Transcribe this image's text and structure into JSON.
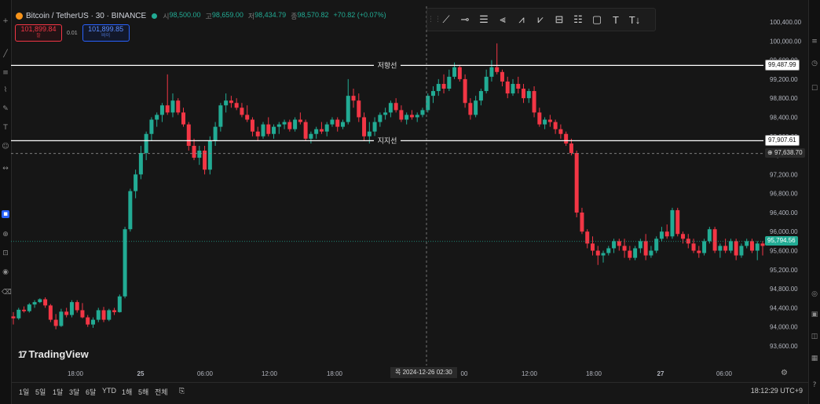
{
  "symbol": {
    "title": "Bitcoin / TetherUS · 30 · BINANCE",
    "ohlc": [
      {
        "label": "시",
        "value": "98,500.00"
      },
      {
        "label": "고",
        "value": "98,659.00"
      },
      {
        "label": "저",
        "value": "98,434.79"
      },
      {
        "label": "종",
        "value": "98,570.82"
      },
      {
        "label": "",
        "value": "+70.82 (+0.07%)"
      }
    ]
  },
  "orders": {
    "sell_price": "101,899.84",
    "sell_label": "팔",
    "spread": "0.01",
    "buy_price": "101,899.85",
    "buy_label": "바이"
  },
  "drawing_tools": [
    "trend-line",
    "horizontal-ray",
    "parallel-channel",
    "pitchfork",
    "zigzag-pattern",
    "long-position",
    "price-range",
    "rectangle",
    "text",
    "anchored-text"
  ],
  "price_axis": {
    "min": 93400,
    "max": 100600,
    "ticks": [
      "100,400.00",
      "100,000.00",
      "99,600.00",
      "99,200.00",
      "98,800.00",
      "98,400.00",
      "98,000.00",
      "97,600.00",
      "97,200.00",
      "96,800.00",
      "96,400.00",
      "96,000.00",
      "95,600.00",
      "95,200.00",
      "94,800.00",
      "94,400.00",
      "94,000.00",
      "93,600.00"
    ]
  },
  "time_axis": {
    "labels": [
      "18:00",
      "25",
      "06:00",
      "12:00",
      "18:00",
      "00",
      "12:00",
      "18:00",
      "27",
      "06:00"
    ]
  },
  "lines": {
    "resistance": {
      "label": "저항선",
      "price": 99487.99,
      "tag": "99,487.99"
    },
    "support": {
      "label": "지지선",
      "price": 97907.61,
      "tag": "97,907.61"
    }
  },
  "crosshair": {
    "price_tag": "97,638.70",
    "time_tag": "목 2024-12-26   02:30",
    "price": 97638.7
  },
  "last_price_tag": "95,794.56",
  "logo_text": "TradingView",
  "bottom": {
    "ranges": [
      "1일",
      "5일",
      "1달",
      "3달",
      "6달",
      "YTD",
      "1해",
      "5해",
      "전체"
    ],
    "clock": "18:12:29 UTC+9"
  },
  "colors": {
    "up": "#22ab94",
    "down": "#f23645",
    "background": "#161616"
  },
  "chart_data": {
    "type": "candlestick",
    "candles": [
      [
        94220,
        94310,
        94050,
        94180
      ],
      [
        94180,
        94400,
        94150,
        94360
      ],
      [
        94360,
        94430,
        94300,
        94330
      ],
      [
        94330,
        94500,
        94300,
        94470
      ],
      [
        94470,
        94560,
        94400,
        94520
      ],
      [
        94520,
        94600,
        94500,
        94580
      ],
      [
        94580,
        94620,
        94400,
        94450
      ],
      [
        94450,
        94480,
        94100,
        94150
      ],
      [
        94150,
        94270,
        93950,
        94020
      ],
      [
        94020,
        94380,
        94000,
        94320
      ],
      [
        94320,
        94400,
        94200,
        94250
      ],
      [
        94250,
        94560,
        94200,
        94520
      ],
      [
        94520,
        94560,
        94300,
        94350
      ],
      [
        94350,
        94500,
        94180,
        94200
      ],
      [
        94200,
        94250,
        94000,
        94050
      ],
      [
        94050,
        94200,
        93980,
        94150
      ],
      [
        94150,
        94400,
        94100,
        94350
      ],
      [
        94350,
        94420,
        94100,
        94150
      ],
      [
        94150,
        94380,
        94120,
        94350
      ],
      [
        94350,
        94400,
        94250,
        94310
      ],
      [
        94310,
        94680,
        94300,
        94640
      ],
      [
        94640,
        96100,
        94600,
        96050
      ],
      [
        96050,
        96900,
        96000,
        96850
      ],
      [
        96850,
        97300,
        96700,
        97200
      ],
      [
        97200,
        97800,
        97100,
        97650
      ],
      [
        97650,
        98100,
        97500,
        98050
      ],
      [
        98050,
        98400,
        97900,
        98350
      ],
      [
        98350,
        98500,
        98200,
        98450
      ],
      [
        98450,
        98700,
        98300,
        98650
      ],
      [
        98650,
        99300,
        98450,
        98500
      ],
      [
        98500,
        98900,
        98400,
        98750
      ],
      [
        98750,
        98800,
        98450,
        98500
      ],
      [
        98500,
        98600,
        98200,
        98250
      ],
      [
        98250,
        98300,
        97700,
        97800
      ],
      [
        97800,
        97950,
        97500,
        97550
      ],
      [
        97550,
        97800,
        97400,
        97700
      ],
      [
        97700,
        97800,
        97200,
        97300
      ],
      [
        97300,
        98000,
        97200,
        97900
      ],
      [
        97900,
        98300,
        97800,
        98200
      ],
      [
        98200,
        98700,
        98100,
        98650
      ],
      [
        98650,
        98900,
        98500,
        98750
      ],
      [
        98750,
        98850,
        98600,
        98700
      ],
      [
        98700,
        98800,
        98550,
        98600
      ],
      [
        98600,
        98700,
        98400,
        98450
      ],
      [
        98450,
        98650,
        98300,
        98350
      ],
      [
        98350,
        98400,
        98000,
        98100
      ],
      [
        98100,
        98200,
        97900,
        98000
      ],
      [
        98000,
        98300,
        97950,
        98250
      ],
      [
        98250,
        98400,
        98000,
        98050
      ],
      [
        98050,
        98250,
        97950,
        98200
      ],
      [
        98200,
        98300,
        98050,
        98250
      ],
      [
        98250,
        98350,
        98150,
        98300
      ],
      [
        98300,
        98350,
        98100,
        98150
      ],
      [
        98150,
        98400,
        98100,
        98350
      ],
      [
        98350,
        98500,
        98250,
        98300
      ],
      [
        98300,
        98350,
        97900,
        97950
      ],
      [
        97950,
        98100,
        97850,
        98050
      ],
      [
        98050,
        98200,
        97950,
        98150
      ],
      [
        98150,
        98300,
        98050,
        98100
      ],
      [
        98100,
        98300,
        98000,
        98250
      ],
      [
        98250,
        98400,
        98200,
        98350
      ],
      [
        98350,
        98400,
        98100,
        98200
      ],
      [
        98200,
        98350,
        98150,
        98300
      ],
      [
        98300,
        99200,
        98250,
        98850
      ],
      [
        98850,
        99000,
        98600,
        98750
      ],
      [
        98750,
        98900,
        98300,
        98400
      ],
      [
        98400,
        98500,
        97900,
        98000
      ],
      [
        98000,
        98300,
        97850,
        98100
      ],
      [
        98100,
        98400,
        98000,
        98300
      ],
      [
        98300,
        98500,
        98200,
        98450
      ],
      [
        98450,
        98600,
        98350,
        98500
      ],
      [
        98500,
        98750,
        98400,
        98700
      ],
      [
        98700,
        98800,
        98500,
        98550
      ],
      [
        98550,
        98650,
        98300,
        98350
      ],
      [
        98350,
        98500,
        98250,
        98450
      ],
      [
        98450,
        98550,
        98350,
        98400
      ],
      [
        98400,
        98500,
        98300,
        98450
      ],
      [
        98450,
        98600,
        98400,
        98550
      ],
      [
        98550,
        98900,
        98500,
        98850
      ],
      [
        98850,
        99050,
        98700,
        98950
      ],
      [
        98950,
        99200,
        98850,
        99100
      ],
      [
        99100,
        99300,
        98900,
        99000
      ],
      [
        99000,
        99400,
        98950,
        99250
      ],
      [
        99250,
        99550,
        99200,
        99450
      ],
      [
        99450,
        99500,
        99150,
        99200
      ],
      [
        99200,
        99300,
        98600,
        98700
      ],
      [
        98700,
        98800,
        98350,
        98450
      ],
      [
        98450,
        98850,
        98400,
        98750
      ],
      [
        98750,
        99000,
        98650,
        98950
      ],
      [
        98950,
        99400,
        98900,
        99250
      ],
      [
        99250,
        99600,
        99150,
        99450
      ],
      [
        99450,
        99950,
        99300,
        99350
      ],
      [
        99350,
        99400,
        99050,
        99150
      ],
      [
        99150,
        99250,
        98800,
        98900
      ],
      [
        98900,
        99200,
        98850,
        99100
      ],
      [
        99100,
        99250,
        98900,
        99000
      ],
      [
        99000,
        99100,
        98700,
        98800
      ],
      [
        98800,
        99000,
        98700,
        98950
      ],
      [
        98950,
        99050,
        98400,
        98500
      ],
      [
        98500,
        98600,
        98200,
        98250
      ],
      [
        98250,
        98400,
        98150,
        98350
      ],
      [
        98350,
        98450,
        98200,
        98300
      ],
      [
        98300,
        98350,
        98050,
        98150
      ],
      [
        98150,
        98250,
        97950,
        98050
      ],
      [
        98050,
        98100,
        97800,
        97850
      ],
      [
        97850,
        97950,
        97600,
        97650
      ],
      [
        97650,
        97700,
        96300,
        96400
      ],
      [
        96400,
        96500,
        95950,
        96000
      ],
      [
        96000,
        96050,
        95650,
        95750
      ],
      [
        95750,
        95900,
        95500,
        95600
      ],
      [
        95600,
        95700,
        95300,
        95500
      ],
      [
        95500,
        95600,
        95350,
        95550
      ],
      [
        95550,
        95700,
        95500,
        95650
      ],
      [
        95650,
        95850,
        95550,
        95800
      ],
      [
        95800,
        95850,
        95600,
        95700
      ],
      [
        95700,
        95850,
        95450,
        95600
      ],
      [
        95600,
        95700,
        95400,
        95450
      ],
      [
        95450,
        95700,
        95400,
        95650
      ],
      [
        95650,
        95850,
        95550,
        95800
      ],
      [
        95800,
        95950,
        95400,
        95500
      ],
      [
        95500,
        95700,
        95450,
        95600
      ],
      [
        95600,
        95900,
        95550,
        95850
      ],
      [
        95850,
        96100,
        95800,
        96000
      ],
      [
        96000,
        96150,
        95850,
        95900
      ],
      [
        95900,
        96500,
        95850,
        96450
      ],
      [
        96450,
        96500,
        95900,
        95950
      ],
      [
        95950,
        96000,
        95750,
        95850
      ],
      [
        95850,
        95950,
        95650,
        95750
      ],
      [
        95750,
        95850,
        95550,
        95600
      ],
      [
        95600,
        95700,
        95450,
        95550
      ],
      [
        95550,
        95850,
        95500,
        95800
      ],
      [
        95800,
        96100,
        95750,
        96050
      ],
      [
        96050,
        96100,
        95550,
        95600
      ],
      [
        95600,
        95750,
        95450,
        95700
      ],
      [
        95700,
        95850,
        95550,
        95600
      ],
      [
        95600,
        95850,
        95550,
        95800
      ],
      [
        95800,
        95850,
        95400,
        95500
      ],
      [
        95500,
        95750,
        95450,
        95700
      ],
      [
        95700,
        95850,
        95650,
        95800
      ],
      [
        95800,
        95850,
        95550,
        95600
      ],
      [
        95600,
        95800,
        95400,
        95750
      ],
      [
        95750,
        95800,
        95500,
        95700
      ]
    ]
  }
}
